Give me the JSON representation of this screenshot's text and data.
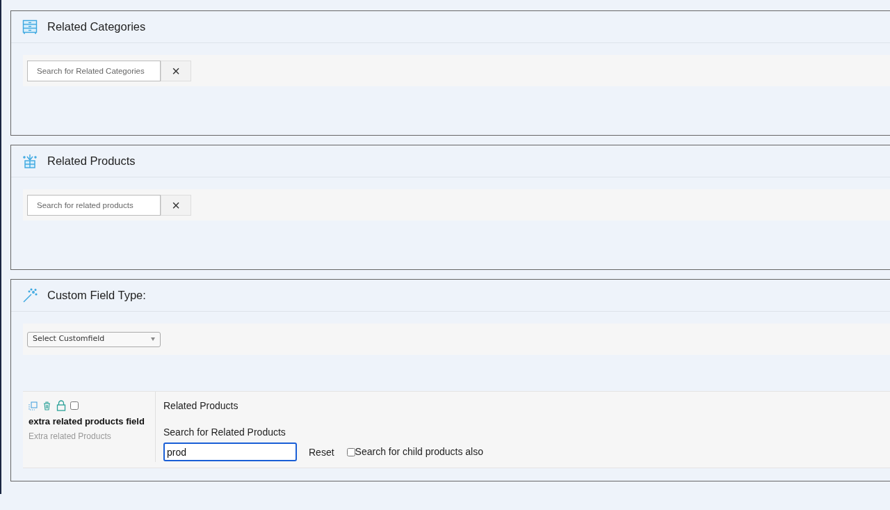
{
  "sections": [
    {
      "kind": "search",
      "title": "Related Categories",
      "placeholder": "Search for Related Categories",
      "clear": "×"
    },
    {
      "kind": "search",
      "title": "Related Products",
      "placeholder": "Search for related products",
      "clear": "×"
    },
    {
      "kind": "select",
      "title": "Custom Field Type:",
      "select": "Select Customfield",
      "field": {
        "name": "extra related products field",
        "subtitle": "Extra related Products",
        "selected": false,
        "title": "Related Products",
        "search_label": "Search for Related Products",
        "search_value": "prod",
        "reset": "Reset",
        "child_products": {
          "label": "Search for child products also",
          "checked": false
        }
      }
    }
  ]
}
